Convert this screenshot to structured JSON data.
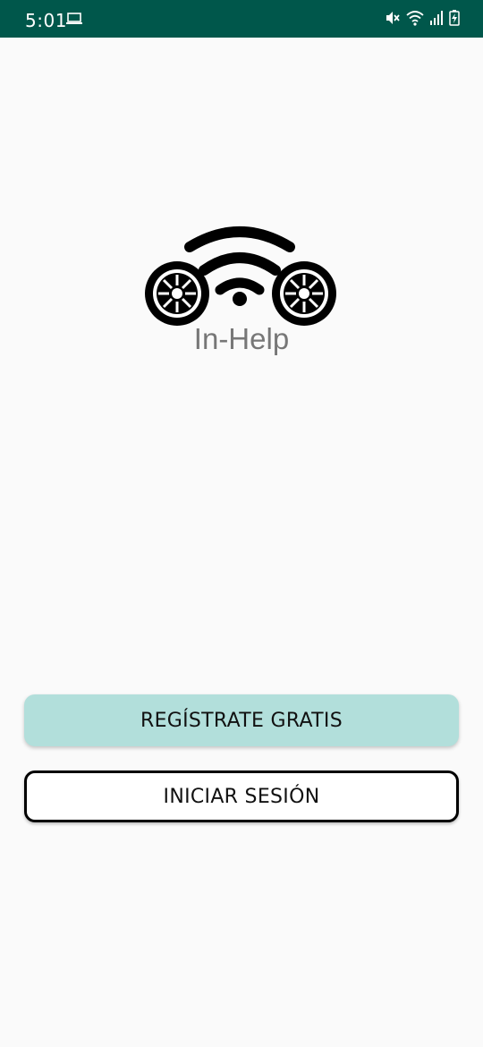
{
  "status_bar": {
    "time": "5:01",
    "icons": [
      "laptop-icon",
      "mute-icon",
      "wifi-icon",
      "signal-icon",
      "battery-icon"
    ],
    "background": "#00574b"
  },
  "brand": {
    "app_name": "In-Help",
    "logo": "wheels-with-wifi-logo"
  },
  "actions": {
    "register_label": "REGÍSTRATE GRATIS",
    "login_label": "INICIAR SESIÓN"
  },
  "colors": {
    "register_button": "#b2dfdb",
    "login_button_border": "#000000",
    "background": "#fafafa"
  }
}
